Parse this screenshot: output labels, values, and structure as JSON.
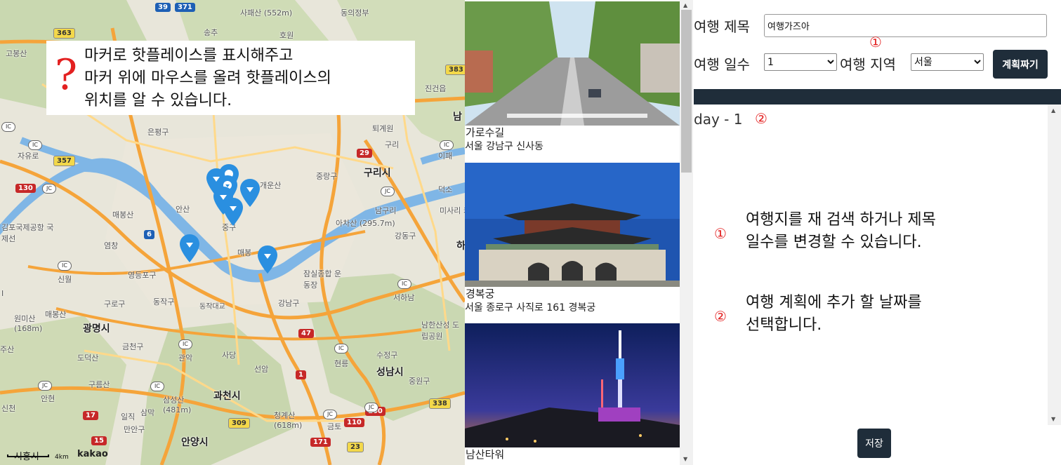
{
  "map": {
    "tooltip": {
      "icon": "?",
      "lines": [
        "마커로 핫플레이스를 표시해주고",
        "마커 위에 마우스를 올려 핫플레이스의",
        "위치를 알 수 있습니다."
      ]
    },
    "labels": [
      "사패산 (552m)",
      "동의정부",
      "송추",
      "호원",
      "고봉산",
      "진건읍",
      "남",
      "퇴계원",
      "은평구",
      "구리",
      "이패",
      "자유로",
      "중랑구",
      "구리시",
      "덕소",
      "개운산",
      "매봉산",
      "안산",
      "아차산 (295.7m)",
      "남구리",
      "미사리 카누경",
      "김포국제공항 국제선",
      "염창",
      "매봉",
      "강동구",
      "하",
      "신월",
      "영등포구",
      "잠실종합 운동장",
      "구로구",
      "동작구",
      "동작대교",
      "강남구",
      "서하남",
      "매봉산",
      "원미산 (168m)",
      "광명시",
      "남한산성 도립공원",
      "금천구",
      "사당",
      "현릉",
      "도덕산",
      "관악",
      "선암",
      "수정구",
      "성남시",
      "구름산",
      "삼성산 (481m)",
      "과천시",
      "중원구",
      "청계산 (618m)",
      "신천",
      "안현",
      "일직",
      "삼막",
      "만안구",
      "금토",
      "안양시",
      "주산",
      "중구",
      "I"
    ],
    "scale": "4km",
    "attribution": "kakao",
    "city_corner": "시흥시"
  },
  "places": [
    {
      "name": "가로수길",
      "address": "서울 강남구 신사동",
      "photo": "street-photo"
    },
    {
      "name": "경복궁",
      "address": "서울 종로구 사직로 161 경복궁",
      "photo": "palace-photo"
    },
    {
      "name": "남산타워",
      "address": "",
      "photo": "tower-photo"
    }
  ],
  "plan": {
    "title_label": "여행 제목",
    "title_value": "여행가즈아",
    "days_label": "여행 일수",
    "days_value": "1",
    "region_label": "여행 지역",
    "region_value": "서울",
    "plan_button": "계획짜기",
    "day_label": "day - 1",
    "marker_1": "①",
    "marker_2": "②",
    "note_1": [
      "여행지를 재 검색 하거나 제목",
      "일수를 변경할 수 있습니다."
    ],
    "note_2": [
      "여행 계획에 추가 할 날짜를",
      "선택합니다."
    ],
    "save_button": "저장"
  },
  "colors": {
    "accent_dark": "#1f2d3a",
    "annotation_red": "#e32020",
    "marker_blue": "#2a8fe0"
  }
}
